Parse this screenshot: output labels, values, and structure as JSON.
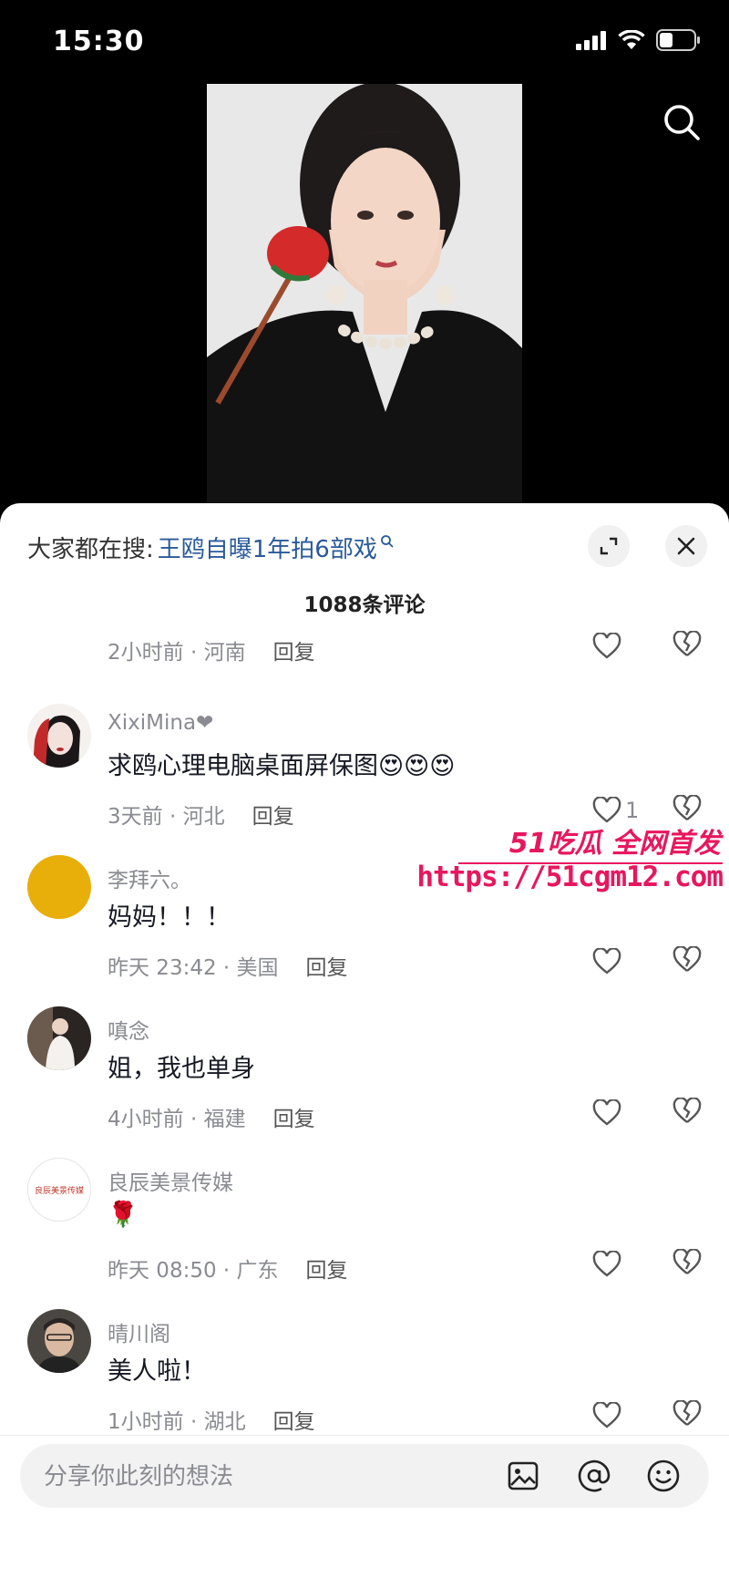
{
  "status_bar": {
    "time": "15:30"
  },
  "trending": {
    "prefix": "大家都在搜:",
    "keyword": "王鸥自曝1年拍6部戏"
  },
  "comments_count": "1088条评论",
  "partial_comment": {
    "meta": "2小时前 · 河南",
    "reply": "回复"
  },
  "comments": [
    {
      "name": "XixiMina❤",
      "text": "求鸥心理电脑桌面屏保图😍😍😍",
      "meta": "3天前 · 河北",
      "reply": "回复",
      "likes": "1"
    },
    {
      "name": "李拜六。",
      "text": "妈妈！！！",
      "meta": "昨天 23:42 · 美国",
      "reply": "回复",
      "likes": ""
    },
    {
      "name": "嗔念",
      "text": "姐，我也单身",
      "meta": "4小时前 · 福建",
      "reply": "回复",
      "likes": ""
    },
    {
      "name": "良辰美景传媒",
      "text": "🌹",
      "meta": "昨天 08:50 · 广东",
      "reply": "回复",
      "likes": "",
      "avatar_text": "良辰美景传媒"
    },
    {
      "name": "晴川阁",
      "text": "美人啦！",
      "meta": "1小时前 · 湖北",
      "reply": "回复",
      "likes": ""
    }
  ],
  "watermark": {
    "title": "51吃瓜 全网首发",
    "url": "https://51cgm12.com"
  },
  "input": {
    "placeholder": "分享你此刻的想法"
  },
  "icons": {
    "search": "search-icon",
    "expand": "expand-icon",
    "close": "close-icon",
    "heart": "heart-icon",
    "broken_heart": "broken-heart-icon",
    "image": "image-icon",
    "at": "at-icon",
    "emoji": "emoji-icon"
  },
  "colors": {
    "accent_link": "#2a5a9a",
    "watermark": "#e8175d",
    "avatar_yellow": "#e8ae0a"
  }
}
